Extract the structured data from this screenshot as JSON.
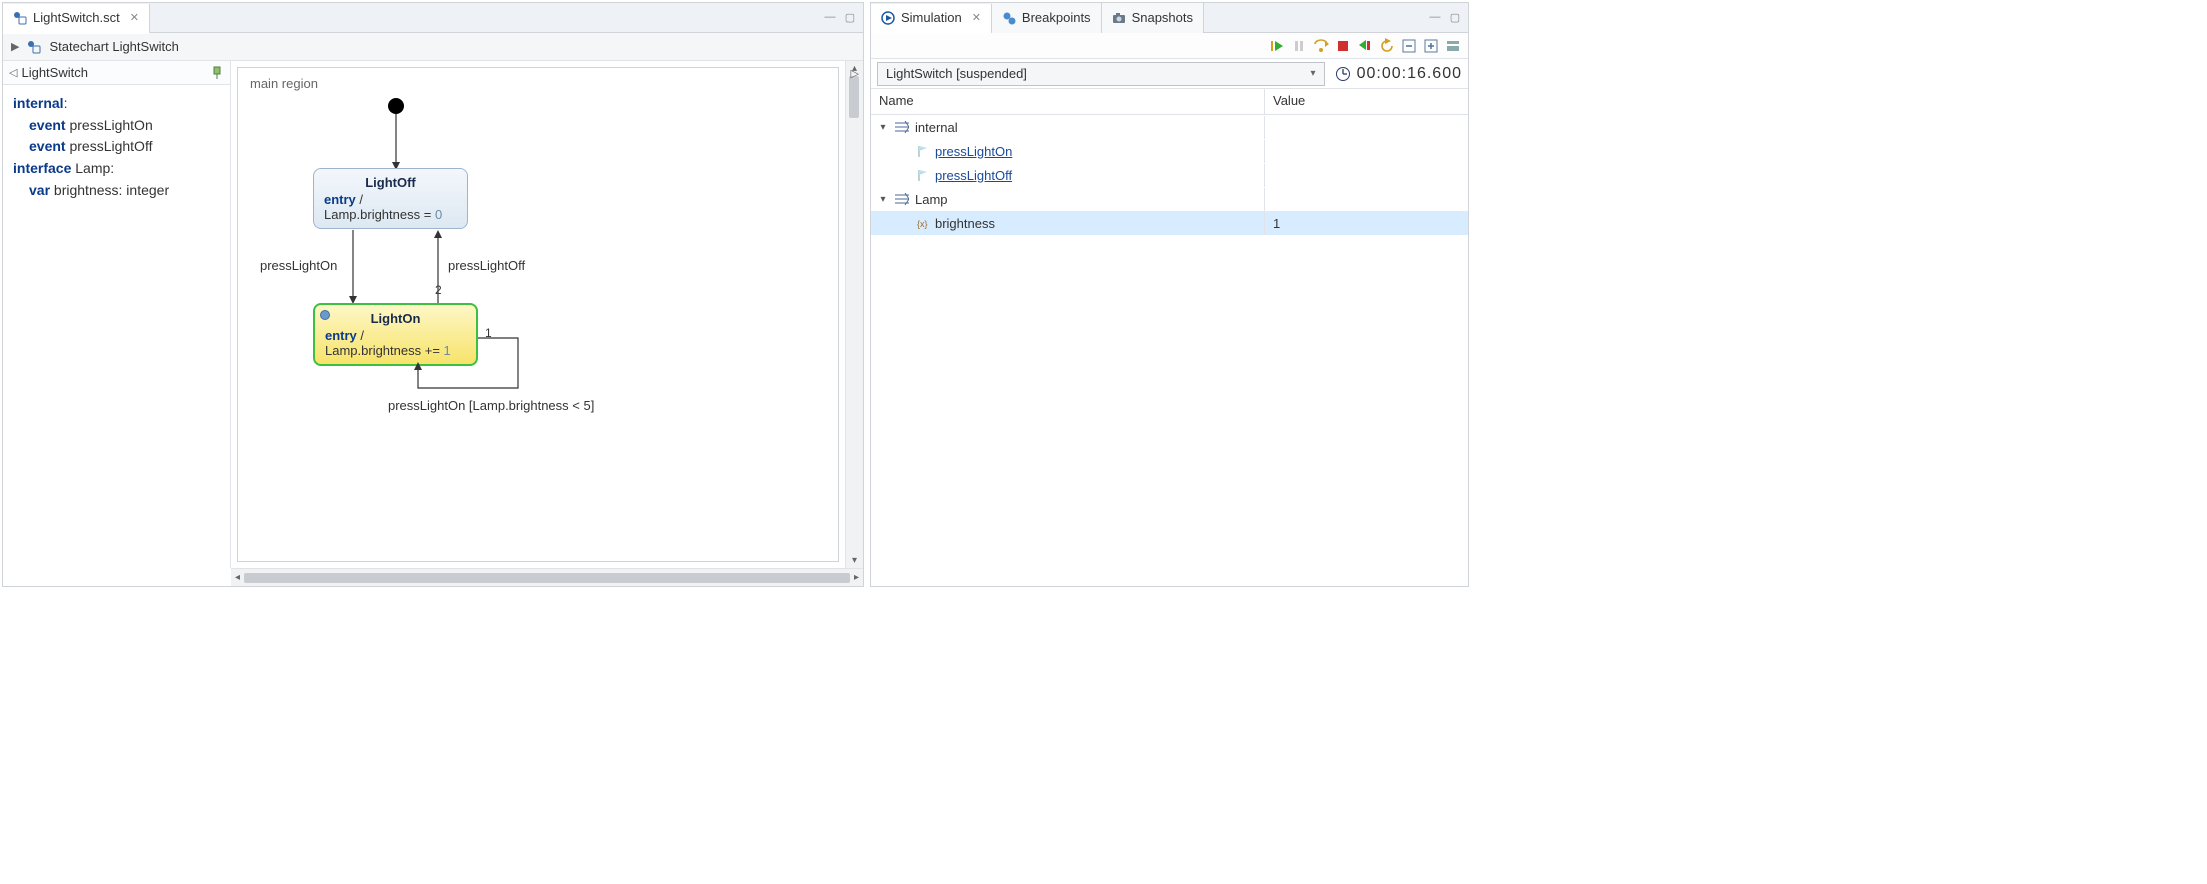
{
  "left": {
    "tab_file": "LightSwitch.sct",
    "crumb": "Statechart LightSwitch",
    "def_title": "LightSwitch",
    "code": {
      "internal_kw": "internal",
      "event_kw": "event",
      "ev1": "pressLightOn",
      "ev2": "pressLightOff",
      "interface_kw": "interface",
      "iface_name": "Lamp",
      "var_kw": "var",
      "var_name": "brightness",
      "var_type": "integer"
    },
    "diagram": {
      "region_label": "main region",
      "state_off": {
        "title": "LightOff",
        "entry_kw": "entry",
        "body_pre": "Lamp.brightness = ",
        "body_val": "0"
      },
      "state_on": {
        "title": "LightOn",
        "entry_kw": "entry",
        "body_pre": "Lamp.brightness += ",
        "body_val": "1"
      },
      "trans_on": "pressLightOn",
      "trans_off": "pressLightOff",
      "trans_off_prio": "2",
      "trans_self_prio": "1",
      "trans_self": "pressLightOn [Lamp.brightness < 5]"
    }
  },
  "right": {
    "tabs": {
      "sim": "Simulation",
      "bp": "Breakpoints",
      "snap": "Snapshots"
    },
    "combo": "LightSwitch [suspended]",
    "clock": "00:00:16.600",
    "cols": {
      "name": "Name",
      "value": "Value"
    },
    "tree": {
      "internal": "internal",
      "ev1": "pressLightOn",
      "ev2": "pressLightOff",
      "lamp": "Lamp",
      "brightness_name": "brightness",
      "brightness_val": "1"
    }
  }
}
